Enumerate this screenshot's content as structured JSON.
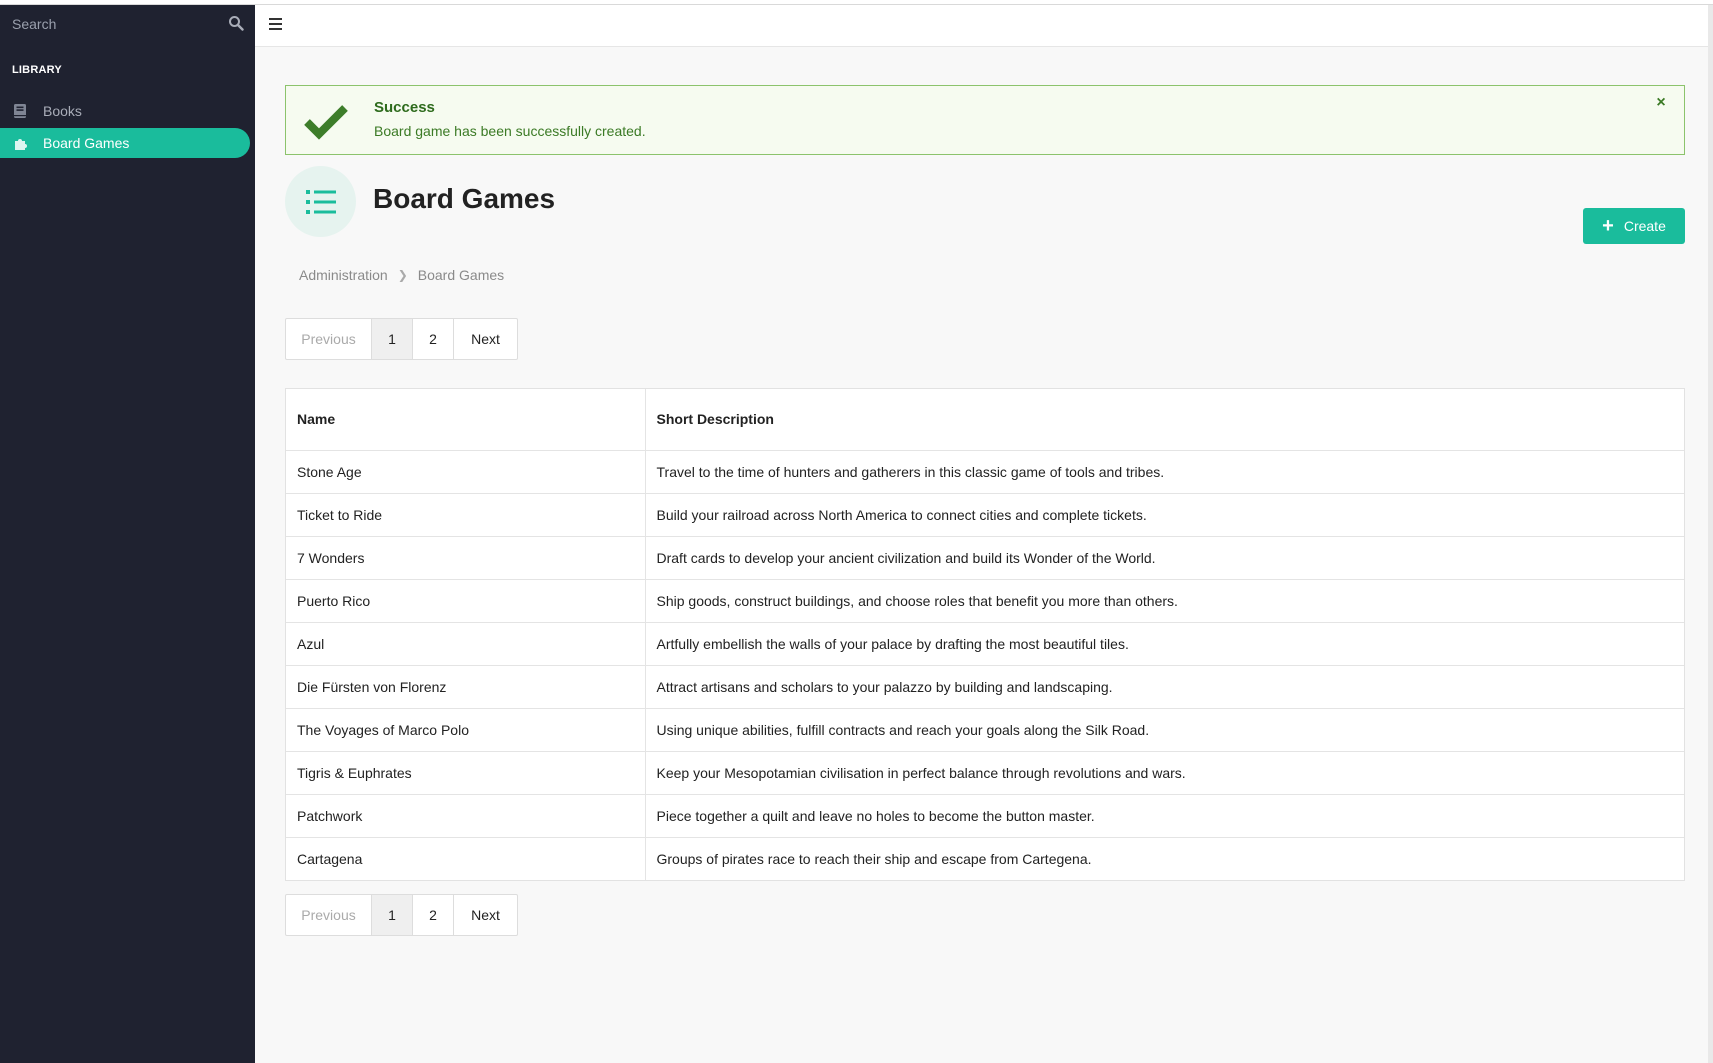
{
  "search": {
    "placeholder": "Search"
  },
  "sidebar": {
    "heading": "LIBRARY",
    "items": [
      {
        "label": "Books",
        "icon": "book-icon",
        "active": false
      },
      {
        "label": "Board Games",
        "icon": "puzzle-icon",
        "active": true
      }
    ]
  },
  "alert": {
    "title": "Success",
    "message": "Board game has been successfully created.",
    "close": "×"
  },
  "page": {
    "title": "Board Games",
    "create_label": "Create"
  },
  "breadcrumb": [
    "Administration",
    "Board Games"
  ],
  "pagination": {
    "previous": "Previous",
    "pages": [
      "1",
      "2"
    ],
    "next": "Next",
    "current": "1"
  },
  "table": {
    "headers": [
      "Name",
      "Short Description"
    ],
    "rows": [
      [
        "Stone Age",
        "Travel to the time of hunters and gatherers in this classic game of tools and tribes."
      ],
      [
        "Ticket to Ride",
        "Build your railroad across North America to connect cities and complete tickets."
      ],
      [
        "7 Wonders",
        "Draft cards to develop your ancient civilization and build its Wonder of the World."
      ],
      [
        "Puerto Rico",
        "Ship goods, construct buildings, and choose roles that benefit you more than others."
      ],
      [
        "Azul",
        "Artfully embellish the walls of your palace by drafting the most beautiful tiles."
      ],
      [
        "Die Fürsten von Florenz",
        "Attract artisans and scholars to your palazzo by building and landscaping."
      ],
      [
        "The Voyages of Marco Polo",
        "Using unique abilities, fulfill contracts and reach your goals along the Silk Road."
      ],
      [
        "Tigris & Euphrates",
        "Keep your Mesopotamian civilisation in perfect balance through revolutions and wars."
      ],
      [
        "Patchwork",
        "Piece together a quilt and leave no holes to become the button master."
      ],
      [
        "Cartagena",
        "Groups of pirates race to reach their ship and escape from Cartegena."
      ]
    ]
  },
  "colors": {
    "accent": "#1abc9c",
    "sidebar_bg": "#1f2230",
    "success_border": "#8cc36c",
    "success_text": "#2e6b1d"
  }
}
